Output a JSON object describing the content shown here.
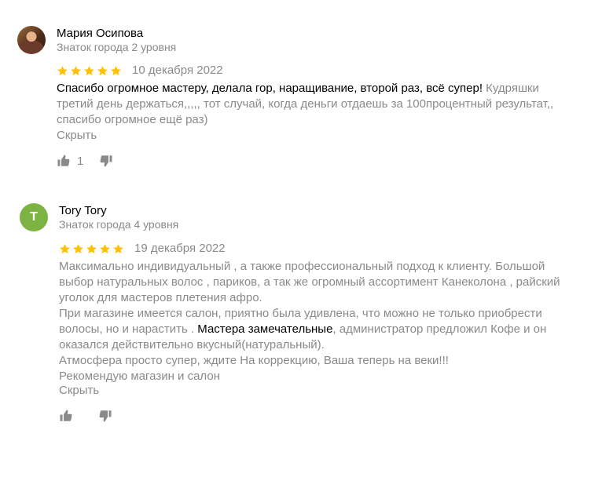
{
  "reviews": [
    {
      "author": "Мария Осипова",
      "badge": "Знаток города 2 уровня",
      "rating": 5,
      "date": "10 декабря 2022",
      "text_highlight": "Спасибо огромное мастеру, делала гор, наращивание, второй раз, всё супер!",
      "text_rest": " Кудряшки третий день держаться,,,,, тот случай, когда деньги отдаешь за 100процентный результат,, спасибо огромное ещё раз)",
      "hide_label": "Скрыть",
      "likes": "1"
    },
    {
      "author": "Tory Tory",
      "avatar_letter": "T",
      "badge": "Знаток города 4 уровня",
      "rating": 5,
      "date": "19 декабря 2022",
      "text_p1": "Максимально индивидуальный , а также профессиональный подход к клиенту. Большой выбор натуральных волос , париков, а так же огромный ассортимент Канеколона , райский уголок для мастеров плетения афро.",
      "text_p2_before": "При магазине имеется салон, приятно была удивлена, что можно не только приобрести волосы, но и нарастить .",
      "text_p2_highlight": " Мастера замечательные",
      "text_p2_after": ", администратор предложил Кофе и он оказался действительно вкусный(натуральный).",
      "text_p3": "Атмосфера просто супер, ждите На коррекцию, Ваша теперь на веки!!!",
      "text_p4": "Рекомендую магазин и салон",
      "hide_label": "Скрыть"
    }
  ],
  "colors": {
    "star": "#ffc107",
    "muted": "#8a8a8a",
    "avatar_bg": "#7cb342"
  }
}
